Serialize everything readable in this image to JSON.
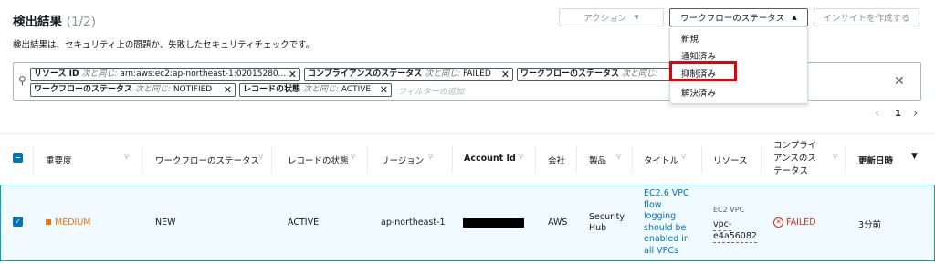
{
  "header": {
    "title": "検出結果",
    "count": "(1/2)",
    "description": "検出結果は、セキュリティ上の問題か、失敗したセキュリティチェックです。"
  },
  "toolbar": {
    "action_label": "アクション",
    "workflow_status_label": "ワークフローのステータス",
    "create_insight_label": "インサイトを作成する"
  },
  "dropdown": {
    "items": [
      "新規",
      "通知済み",
      "抑制済み",
      "解決済み"
    ],
    "highlighted": "抑制済み"
  },
  "filters": {
    "tokens": [
      {
        "key": "リソース ID",
        "op": "次と同じ:",
        "value": "arn:aws:ec2:ap-northeast-1:02015280..."
      },
      {
        "key": "コンプライアンスのステータス",
        "op": "次と同じ:",
        "value": "FAILED"
      },
      {
        "key": "ワークフローのステータス",
        "op": "次と同じ:",
        "value": ""
      },
      {
        "key": "ワークフローのステータス",
        "op": "次と同じ:",
        "value": "NOTIFIED"
      },
      {
        "key": "レコードの状態",
        "op": "次と同じ:",
        "value": "ACTIVE"
      }
    ],
    "placeholder": "フィルターの追加"
  },
  "pagination": {
    "page": "1"
  },
  "table": {
    "columns": [
      "重要度",
      "ワークフローのステータス",
      "レコードの状態",
      "リージョン",
      "Account Id",
      "会社",
      "製品",
      "タイトル",
      "リソース",
      "コンプライアンスのステータス",
      "更新日時"
    ],
    "compliance_header_lines": [
      "コンプライ",
      "アンスのス",
      "テータス"
    ],
    "row": {
      "severity": "MEDIUM",
      "workflow_status": "NEW",
      "record_state": "ACTIVE",
      "region": "ap-northeast-1",
      "company": "AWS",
      "product_lines": [
        "Security",
        "Hub"
      ],
      "title_lines": [
        "EC2.6 VPC",
        "flow",
        "logging",
        "should be",
        "enabled in",
        "all VPCs"
      ],
      "resource_type": "EC2 VPC",
      "resource_id_lines": [
        "vpc-",
        "e4a56082"
      ],
      "compliance": "FAILED",
      "updated": "3分前"
    }
  },
  "colors": {
    "accent": "#0073bb",
    "failed": "#d13212",
    "medium": "#ec7211",
    "highlight": "#e0000f"
  }
}
